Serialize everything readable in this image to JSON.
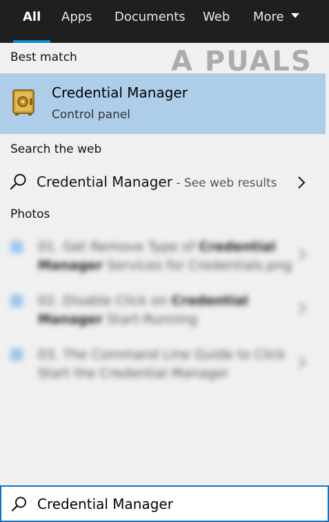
{
  "tabs": {
    "all": "All",
    "apps": "Apps",
    "documents": "Documents",
    "web": "Web",
    "more": "More"
  },
  "watermark": "A PUALS",
  "sections": {
    "best_match": "Best match",
    "search_the_web": "Search the web",
    "photos": "Photos"
  },
  "best_match": {
    "title": "Credential Manager",
    "subtitle": "Control panel",
    "icon": "credential-manager-safe-icon"
  },
  "web_result": {
    "title": "Credential Manager",
    "subtitle": " - See web results"
  },
  "photos": [
    {
      "line1_pre": "01. Get Remove Type of ",
      "line1_bold": "Credential",
      "line2_bold": "Manager",
      "line2_rest": " Services for Credentials.png"
    },
    {
      "line1_pre": "02. Disable Click on ",
      "line1_bold": "Credential",
      "line2_bold": "Manager",
      "line2_rest": " Start-Running"
    },
    {
      "line1_pre": "03. The Command Line Guide to Click",
      "line1_bold": "",
      "line2_bold": "",
      "line2_rest": "Start the Credential Manager"
    }
  ],
  "search": {
    "value": "Credential Manager"
  },
  "colors": {
    "accent": "#0a84d6",
    "selected_bg": "#aecde9",
    "tabbar_bg": "#1f1f1f"
  }
}
